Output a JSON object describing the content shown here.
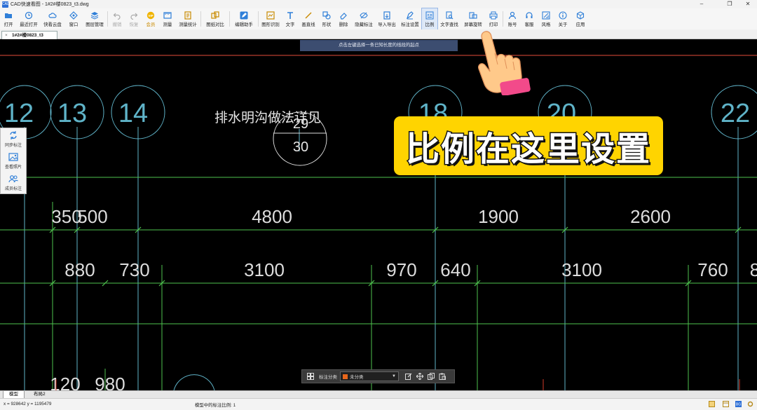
{
  "window": {
    "app_icon_text": "CAD",
    "title": "CAD快速看图 - 1#2#楼0823_t3.dwg",
    "controls": [
      "–",
      "❐",
      "✕"
    ]
  },
  "toolbar": {
    "items": [
      {
        "label": "打开",
        "icon": "folder-icon"
      },
      {
        "label": "最近打开",
        "icon": "clock-icon"
      },
      {
        "label": "快看云盘",
        "icon": "cloud-icon"
      },
      {
        "label": "窗口",
        "icon": "window-icon"
      },
      {
        "label": "图层管理",
        "icon": "layers-icon"
      },
      {
        "label": "撤销",
        "icon": "undo-icon"
      },
      {
        "label": "恢复",
        "icon": "redo-icon"
      },
      {
        "label": "会员",
        "icon": "vip-icon"
      },
      {
        "label": "测量",
        "icon": "ruler-icon"
      },
      {
        "label": "测量统计",
        "icon": "stats-icon"
      },
      {
        "label": "图纸对比",
        "icon": "compare-icon"
      },
      {
        "label": "编辑助手",
        "icon": "edit-helper-icon"
      },
      {
        "label": "图形识别",
        "icon": "recognize-icon"
      },
      {
        "label": "文字",
        "icon": "text-icon"
      },
      {
        "label": "画直线",
        "icon": "line-icon"
      },
      {
        "label": "形状",
        "icon": "shape-icon"
      },
      {
        "label": "删除",
        "icon": "eraser-icon"
      },
      {
        "label": "隐藏标注",
        "icon": "hide-icon"
      },
      {
        "label": "导入导出",
        "icon": "export-icon"
      },
      {
        "label": "标注设置",
        "icon": "annotation-settings-icon"
      },
      {
        "label": "比例",
        "icon": "scale-icon"
      },
      {
        "label": "文字查找",
        "icon": "find-text-icon"
      },
      {
        "label": "屏幕旋转",
        "icon": "rotate-screen-icon"
      },
      {
        "label": "打印",
        "icon": "print-icon"
      },
      {
        "label": "账号",
        "icon": "user-icon"
      },
      {
        "label": "客服",
        "icon": "headset-icon"
      },
      {
        "label": "风格",
        "icon": "style-icon"
      },
      {
        "label": "关于",
        "icon": "info-icon"
      },
      {
        "label": "应用",
        "icon": "apps-icon"
      }
    ]
  },
  "document_tab": {
    "label": "1#2#楼0823_t3",
    "close": "×"
  },
  "hint": "点击左键选择一条已知长度的线段的起点",
  "side_panel": [
    {
      "label": "同步标注",
      "icon": "sync-icon"
    },
    {
      "label": "查看照片",
      "icon": "photo-icon"
    },
    {
      "label": "成员标注",
      "icon": "members-icon"
    }
  ],
  "drawing": {
    "grid_labels": [
      "12",
      "13",
      "14",
      "18",
      "20",
      "22"
    ],
    "note": "排水明沟做法详见",
    "detail_top": "29",
    "detail_bottom": "30",
    "dims_row1": [
      "350",
      "500",
      "4800",
      "1900",
      "2600"
    ],
    "dims_row2": [
      "880",
      "730",
      "3100",
      "970",
      "640",
      "3100",
      "760",
      "8"
    ],
    "dims_row3": [
      "120",
      "980"
    ]
  },
  "caption": "比例在这里设置",
  "float_toolbar": {
    "label": "标注分类",
    "selected": "未分类",
    "swatch_color": "#e8661a"
  },
  "bottom_tabs": [
    "模型",
    "布局2"
  ],
  "status": {
    "coords": "x = 928642  y = 1195479",
    "scale": "模型中的标注比例: 1"
  },
  "colors": {
    "accent": "#2d6fd6",
    "caption_bg": "#ffd400",
    "cad_green": "#4ec24e",
    "cad_cyan": "#5fb3c8"
  }
}
